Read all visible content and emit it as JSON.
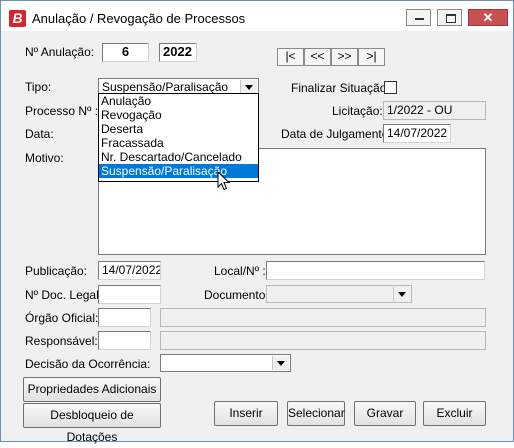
{
  "window": {
    "title": "Anulação / Revogação  de Processos",
    "close_symbol": "✕"
  },
  "anulacao": {
    "label": "Nº Anulação:",
    "numero": "6",
    "ano": "2022"
  },
  "nav": {
    "first": "|<",
    "prev": "<<",
    "next": ">>",
    "last": ">|"
  },
  "tipo": {
    "label": "Tipo:",
    "value": "Suspensão/Paralisação",
    "options": [
      "Anulação",
      "Revogação",
      "Deserta",
      "Fracassada",
      "Nr. Descartado/Cancelado",
      "Suspensão/Paralisação"
    ],
    "selected_index": 5
  },
  "finalizar": {
    "label": "Finalizar Situação:"
  },
  "processo": {
    "label": "Processo Nº :"
  },
  "licitacao": {
    "label": "Licitação:",
    "value": "1/2022 - OU"
  },
  "data": {
    "label": "Data:"
  },
  "julgamento": {
    "label": "Data de Julgamento:",
    "value": "14/07/2022"
  },
  "motivo": {
    "label": "Motivo:"
  },
  "publicacao": {
    "label": "Publicação:",
    "value": "14/07/2022"
  },
  "local": {
    "label": "Local/Nº :"
  },
  "doc_legal": {
    "label": "Nº Doc. Legal:"
  },
  "documento": {
    "label": "Documento:"
  },
  "orgao": {
    "label": "Órgão Oficial:"
  },
  "responsavel": {
    "label": "Responsável:"
  },
  "decisao": {
    "label": "Decisão da Ocorrência:"
  },
  "buttons": {
    "propriedades": "Propriedades Adicionais",
    "desbloqueio": "Desbloqueio de Dotações",
    "inserir": "Inserir",
    "selecionar": "Selecionar",
    "gravar": "Gravar",
    "excluir": "Excluir"
  }
}
